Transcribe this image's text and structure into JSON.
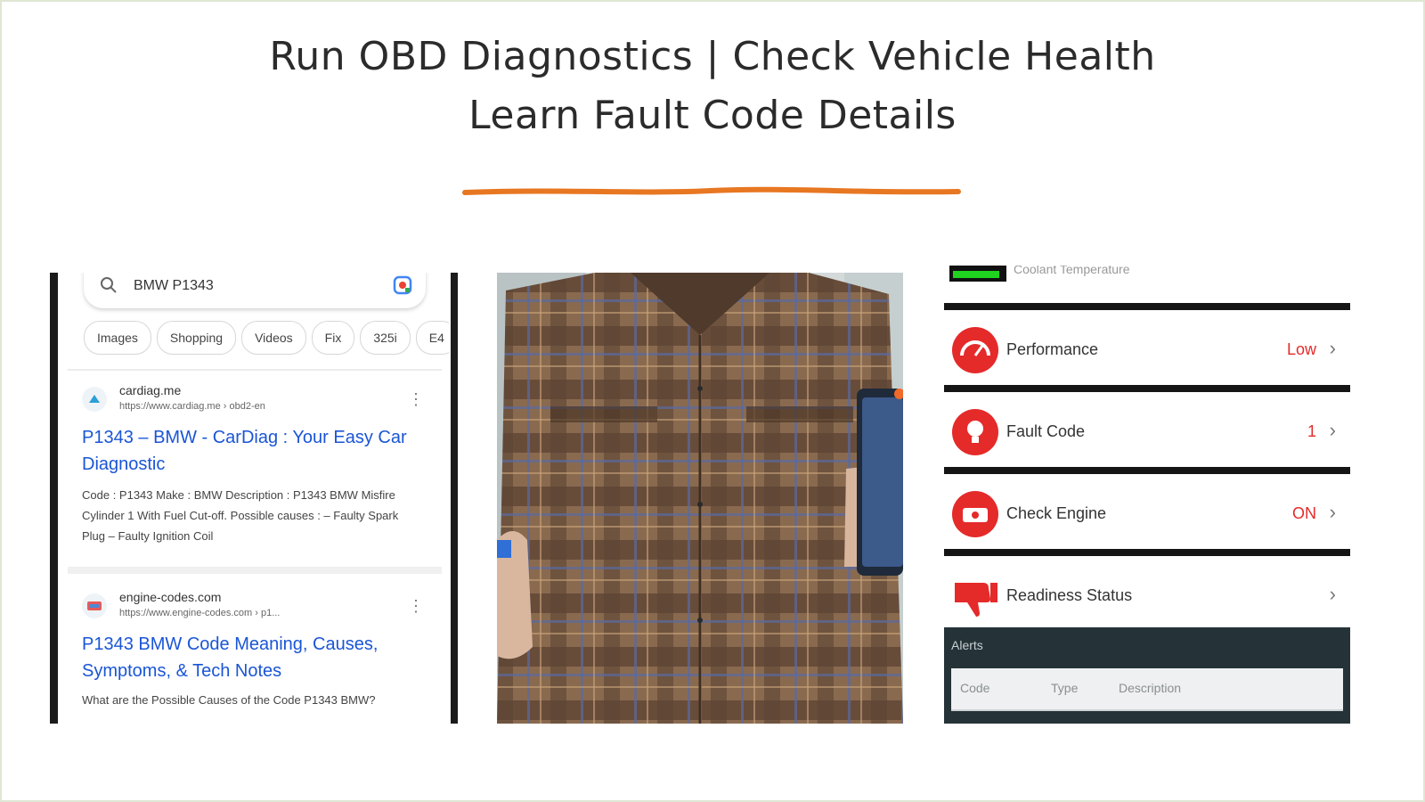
{
  "slide": {
    "headline_line1": "Run OBD Diagnostics  | Check Vehicle Health",
    "headline_line2": "Learn Fault Code Details",
    "accent_color": "#e87722"
  },
  "search_panel": {
    "query": "BMW P1343",
    "chips": [
      "Images",
      "Shopping",
      "Videos",
      "Fix",
      "325i",
      "E4"
    ],
    "results": [
      {
        "site": "cardiag.me",
        "url": "https://www.cardiag.me › obd2-en",
        "title": "P1343 – BMW - CarDiag : Your Easy Car Diagnostic",
        "snippet": "Code : P1343 Make : BMW Description : P1343 BMW Misfire Cylinder 1 With Fuel Cut-off. Possible causes : – Faulty Spark Plug – Faulty Ignition Coil"
      },
      {
        "site": "engine-codes.com",
        "url": "https://www.engine-codes.com › p1...",
        "title": "P1343 BMW Code Meaning, Causes, Symptoms, & Tech Notes",
        "snippet": "What are the Possible Causes of the Code P1343 BMW?"
      }
    ]
  },
  "app_panel": {
    "top_label": "Coolant Temperature",
    "rows": [
      {
        "label": "Performance",
        "value": "Low",
        "icon": "gauge-icon"
      },
      {
        "label": "Fault Code",
        "value": "1",
        "icon": "bulb-icon"
      },
      {
        "label": "Check Engine",
        "value": "ON",
        "icon": "engine-icon"
      },
      {
        "label": "Readiness Status",
        "value": "",
        "icon": "thumbs-down-icon"
      }
    ],
    "alerts": {
      "title": "Alerts",
      "columns": [
        "Code",
        "Type",
        "Description"
      ]
    },
    "icon_color": "#e52a2a"
  }
}
